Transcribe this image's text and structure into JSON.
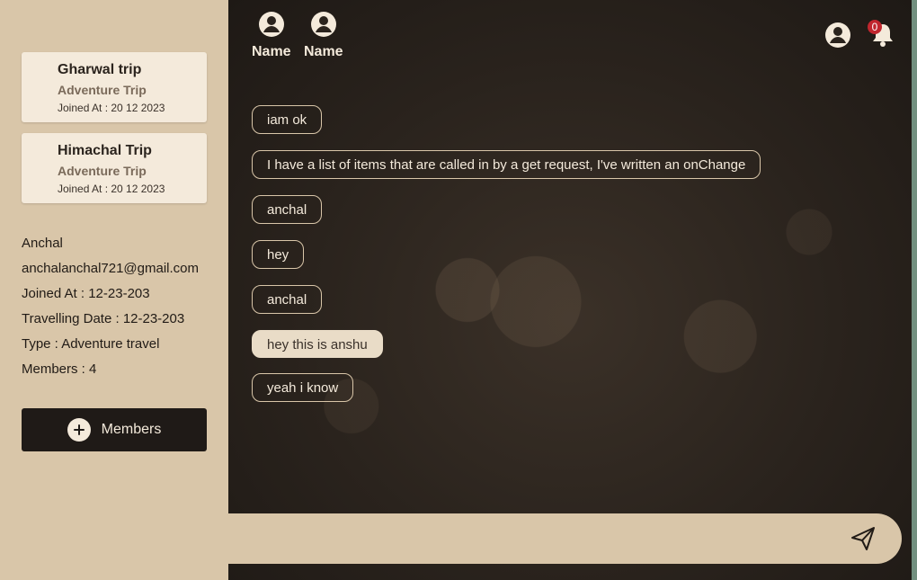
{
  "sidebar": {
    "trips": [
      {
        "title": "Gharwal trip",
        "type": "Adventure Trip",
        "joined": "Joined At : 20 12 2023"
      },
      {
        "title": "Himachal Trip",
        "type": "Adventure Trip",
        "joined": "Joined At : 20 12 2023"
      }
    ],
    "profile": {
      "name": "Anchal",
      "email": "anchalanchal721@gmail.com",
      "joined": "Joined At : 12-23-203",
      "travelling_date": "Travelling Date : 12-23-203",
      "type": "Type : Adventure travel",
      "members": "Members : 4"
    },
    "members_button": "Members"
  },
  "header": {
    "participants": [
      {
        "label": "Name"
      },
      {
        "label": "Name"
      }
    ],
    "notification_count": "0"
  },
  "messages": [
    {
      "text": "iam ok",
      "self": false
    },
    {
      "text": "I have a list of items that are called in by a get request, I've written an onChange",
      "self": false
    },
    {
      "text": "anchal",
      "self": false
    },
    {
      "text": "hey",
      "self": false
    },
    {
      "text": "anchal",
      "self": false
    },
    {
      "text": "hey this is anshu",
      "self": true
    },
    {
      "text": "yeah i know",
      "self": false
    }
  ],
  "composer": {
    "value": "",
    "placeholder": ""
  },
  "colors": {
    "sidebar_bg": "#d9c6a9",
    "card_bg": "#f4eadb",
    "button_dark": "#1f1a17",
    "badge_red": "#c0262e"
  },
  "icons": [
    "user-circle-icon",
    "bell-icon",
    "plus-icon",
    "send-icon"
  ]
}
